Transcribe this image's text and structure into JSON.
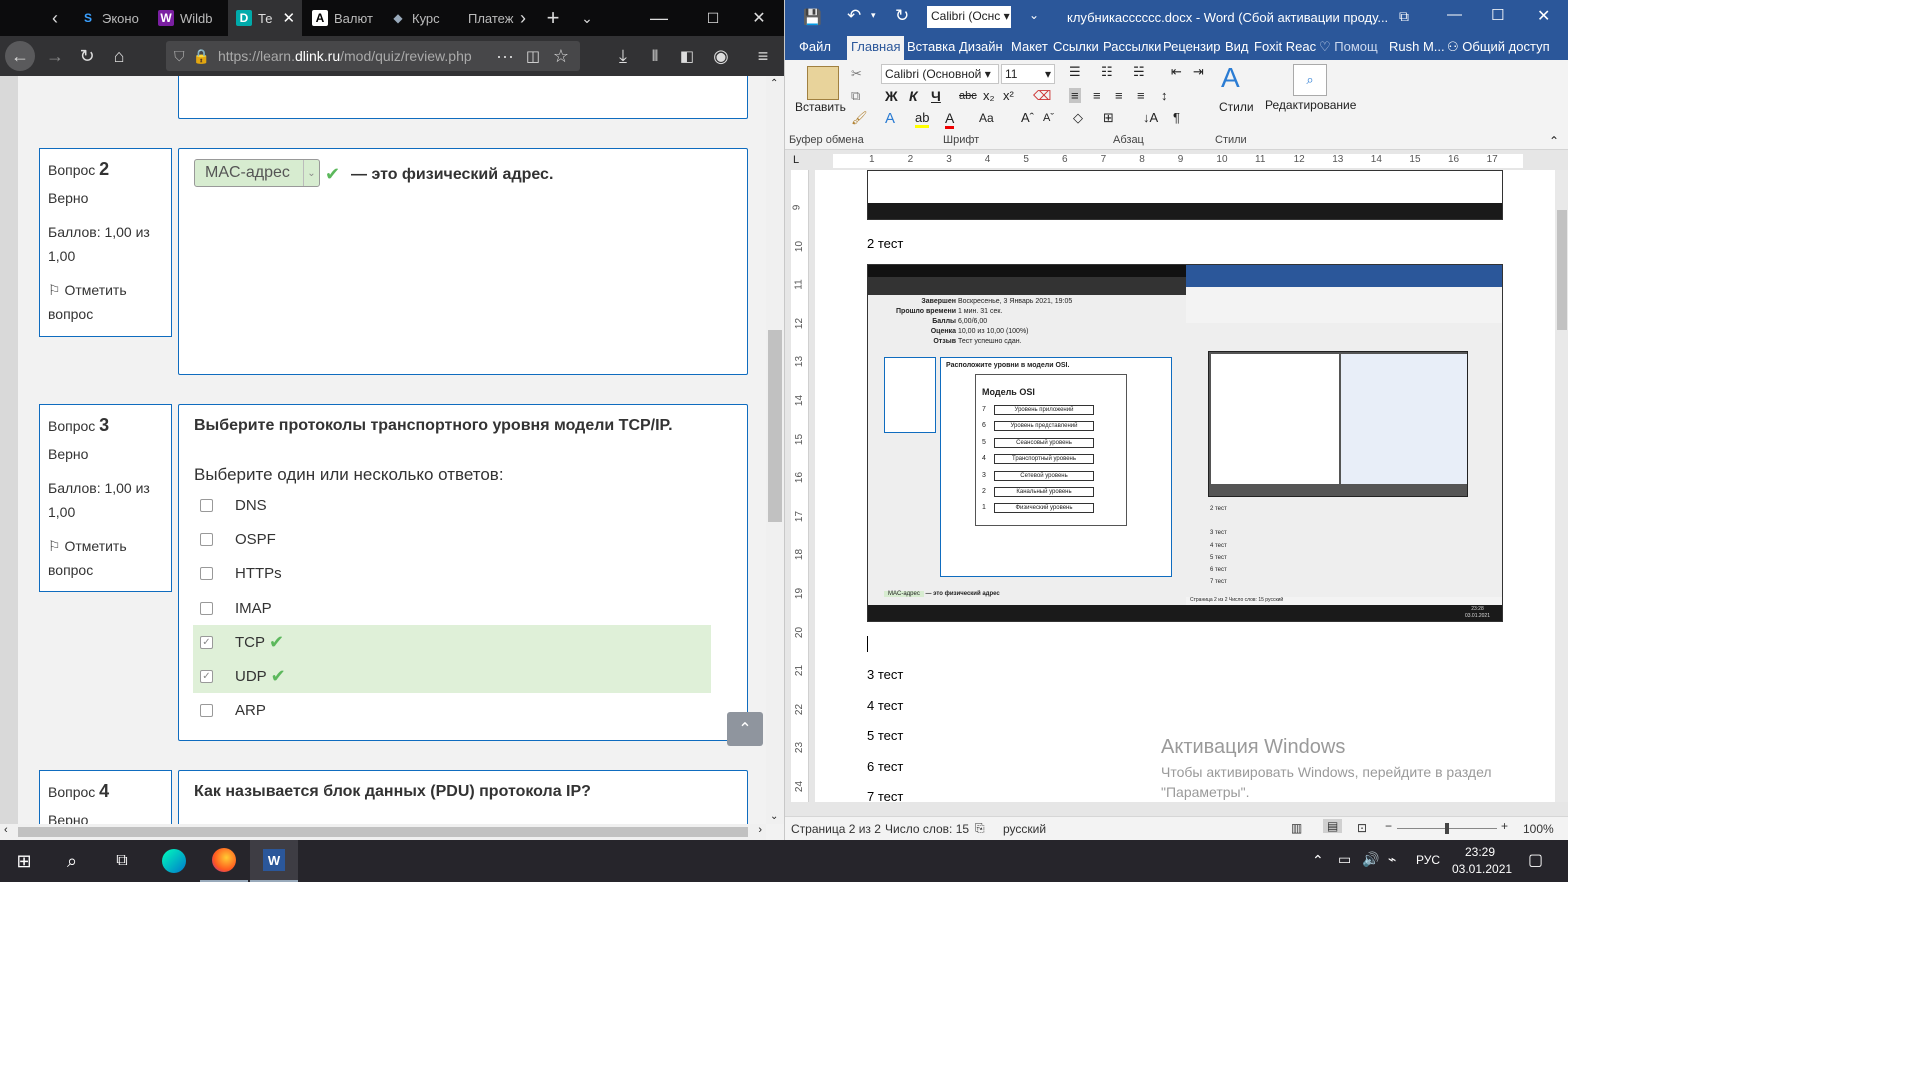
{
  "firefox": {
    "tabs": [
      {
        "label": "Эконо",
        "icon": "S"
      },
      {
        "label": "Wildb",
        "icon": "W"
      },
      {
        "label": "Те",
        "icon": "D"
      },
      {
        "label": "Валют",
        "icon": "A"
      },
      {
        "label": "Курс",
        "icon": "◆"
      },
      {
        "label": "Платеж"
      }
    ],
    "url_prefix": "https://learn.",
    "url_domain": "dlink.ru",
    "url_suffix": "/mod/quiz/review.php"
  },
  "quiz": {
    "q2": {
      "label": "Вопрос",
      "num": "2",
      "status": "Верно",
      "score": "Баллов: 1,00 из 1,00",
      "flag": "Отметить вопрос",
      "answer": "MAC-адрес",
      "text": "— это физический адрес."
    },
    "q3": {
      "label": "Вопрос",
      "num": "3",
      "status": "Верно",
      "score": "Баллов: 1,00 из 1,00",
      "flag": "Отметить вопрос",
      "text": "Выберите протоколы транспортного уровня модели TCP/IP.",
      "prompt": "Выберите один или несколько ответов:",
      "options": [
        {
          "label": "DNS",
          "checked": false
        },
        {
          "label": "OSPF",
          "checked": false
        },
        {
          "label": "HTTPs",
          "checked": false
        },
        {
          "label": "IMAP",
          "checked": false
        },
        {
          "label": "TCP",
          "checked": true
        },
        {
          "label": "UDP",
          "checked": true
        },
        {
          "label": "ARP",
          "checked": false
        }
      ]
    },
    "q4": {
      "label": "Вопрос",
      "num": "4",
      "status": "Верно",
      "text": "Как называется блок данных (PDU) протокола IP?"
    }
  },
  "word": {
    "title": "клубникасссссс.docx - Word (Сбой активации проду...",
    "font_box": "Calibri (Оснс",
    "menu": [
      "Файл",
      "Главная",
      "Вставка",
      "Дизайн",
      "Макет",
      "Ссылки",
      "Рассылки",
      "Рецензир",
      "Вид",
      "Foxit Reac",
      "Помощ",
      "Rush M...",
      "Общий доступ"
    ],
    "ribbon": {
      "paste": "Вставить",
      "font": "Calibri (Основной",
      "size": "11",
      "bold": "Ж",
      "italic": "К",
      "underline": "Ч",
      "strike": "abc",
      "sub": "x₂",
      "sup": "x²",
      "styles": "Стили",
      "editing": "Редактирование",
      "groups": [
        "Буфер обмена",
        "Шрифт",
        "Абзац",
        "Стили"
      ]
    },
    "ruler_nums": [
      "1",
      "2",
      "3",
      "4",
      "5",
      "6",
      "7",
      "8",
      "9",
      "10",
      "11",
      "12",
      "13",
      "14",
      "15",
      "16",
      "17"
    ],
    "vruler_nums": [
      "9",
      "10",
      "11",
      "12",
      "13",
      "14",
      "15",
      "16",
      "17",
      "18",
      "19",
      "20",
      "21",
      "22",
      "23",
      "24"
    ],
    "doc_lines": {
      "t2": "2 тест",
      "t3": "3 тест",
      "t4": "4 тест",
      "t5": "5 тест",
      "t6": "6 тест",
      "t7": "7 тест"
    },
    "nested": {
      "finished_label": "Завершен",
      "finished": "Воскресенье, 3 Январь 2021, 19:05",
      "elapsed_label": "Прошло времени",
      "elapsed": "1 мин. 31 сек.",
      "points_label": "Баллы",
      "points": "6,00/6,00",
      "grade_label": "Оценка",
      "grade": "10,00 из 10,00 (100%)",
      "review_label": "Отзыв",
      "review": "Тест успешно сдан.",
      "q1": "Расположите уровни в модели OSI.",
      "osi_title": "Модель OSI",
      "osi": [
        {
          "n": "7",
          "l": "Уровень приложений"
        },
        {
          "n": "6",
          "l": "Уровень представлений"
        },
        {
          "n": "5",
          "l": "Сеансовый уровень"
        },
        {
          "n": "4",
          "l": "Транспортный уровень"
        },
        {
          "n": "3",
          "l": "Сетевой уровень"
        },
        {
          "n": "2",
          "l": "Канальный уровень"
        },
        {
          "n": "1",
          "l": "Физический уровень"
        }
      ],
      "q2_answer": "MAC-адрес",
      "q2_text": "— это физический адрес",
      "mini_lines": [
        "2 тест",
        "3 тест",
        "4 тест",
        "5 тест",
        "6 тест",
        "7 тест"
      ],
      "mini_status": "Страница 2 из 2   Число слов: 15   русский",
      "mini_time": "23:28",
      "mini_date": "03.01.2021"
    },
    "status": {
      "page": "Страница 2 из 2",
      "words": "Число слов: 15",
      "lang": "русский",
      "zoom": "100%"
    },
    "activation": {
      "title": "Активация Windows",
      "line1": "Чтобы активировать Windows, перейдите в раздел",
      "line2": "\"Параметры\"."
    }
  },
  "taskbar": {
    "lang": "РУС",
    "time": "23:29",
    "date": "03.01.2021"
  }
}
